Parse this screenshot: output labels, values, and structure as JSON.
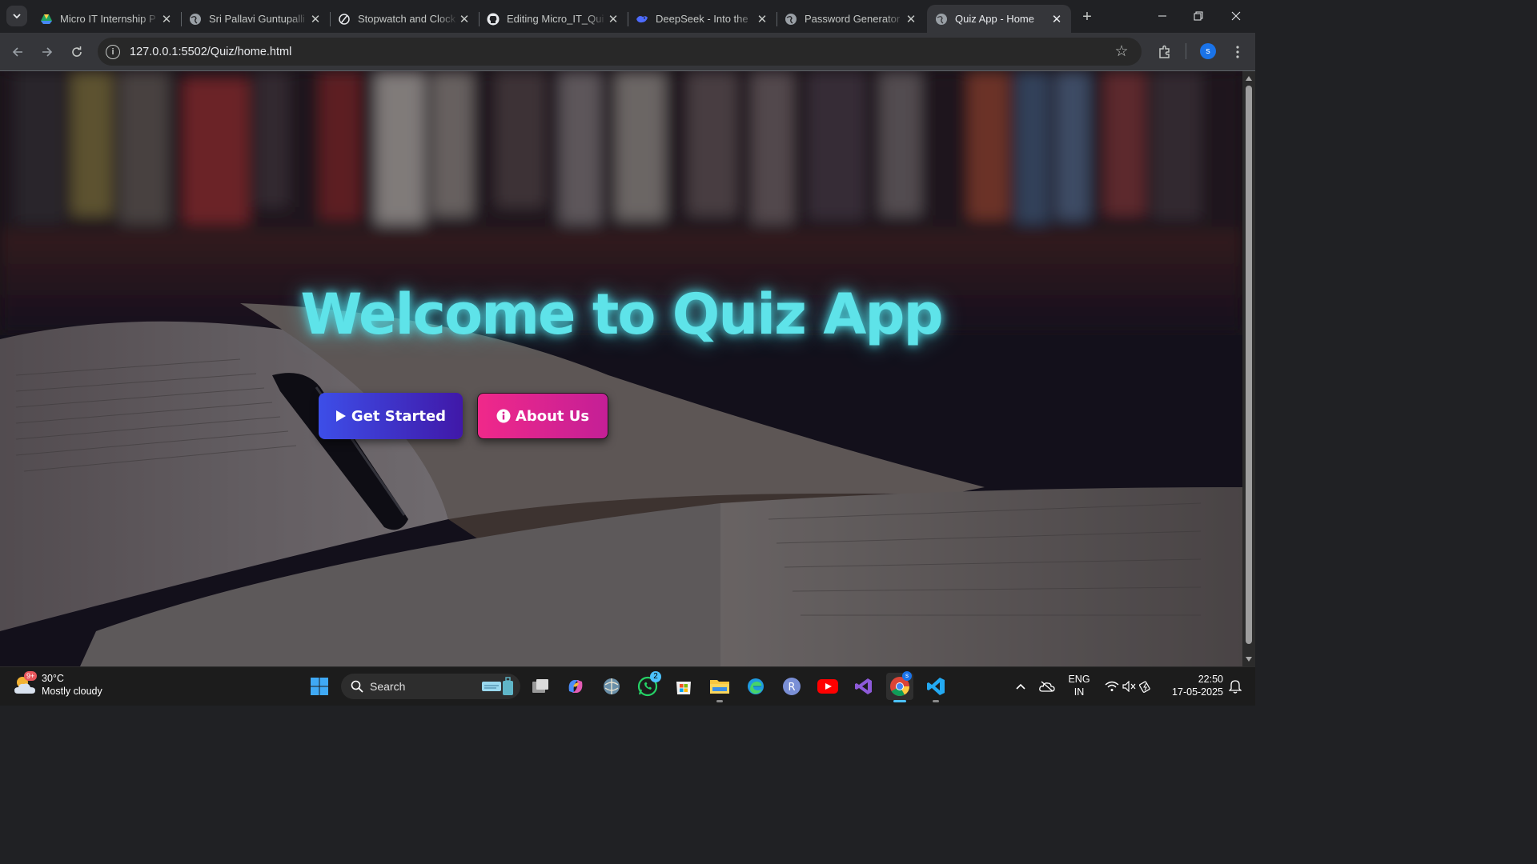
{
  "browser": {
    "tabs": [
      {
        "title": "Micro IT Internship P",
        "icon": "google-drive-icon",
        "active": false
      },
      {
        "title": "Sri Pallavi Guntupalli",
        "icon": "globe-icon",
        "active": false
      },
      {
        "title": "Stopwatch and Clock",
        "icon": "stopwatch-icon",
        "active": false
      },
      {
        "title": "Editing Micro_IT_Qui",
        "icon": "github-icon",
        "active": false
      },
      {
        "title": "DeepSeek - Into the",
        "icon": "deepseek-icon",
        "active": false
      },
      {
        "title": "Password Generator",
        "icon": "globe-icon",
        "active": false
      },
      {
        "title": "Quiz App - Home",
        "icon": "globe-icon",
        "active": true
      }
    ],
    "url": "127.0.0.1:5502/Quiz/home.html",
    "profile_initial": "s"
  },
  "page": {
    "title": "Welcome to Quiz App",
    "get_started_label": "Get Started",
    "about_label": "About Us",
    "title_color": "#5ee3e9"
  },
  "taskbar": {
    "weather_temp": "30°C",
    "weather_desc": "Mostly cloudy",
    "weather_badge": "9+",
    "search_label": "Search",
    "whatsapp_badge": "2",
    "chrome_badge": "s",
    "lang_line1": "ENG",
    "lang_line2": "IN",
    "time": "22:50",
    "date": "17-05-2025"
  }
}
